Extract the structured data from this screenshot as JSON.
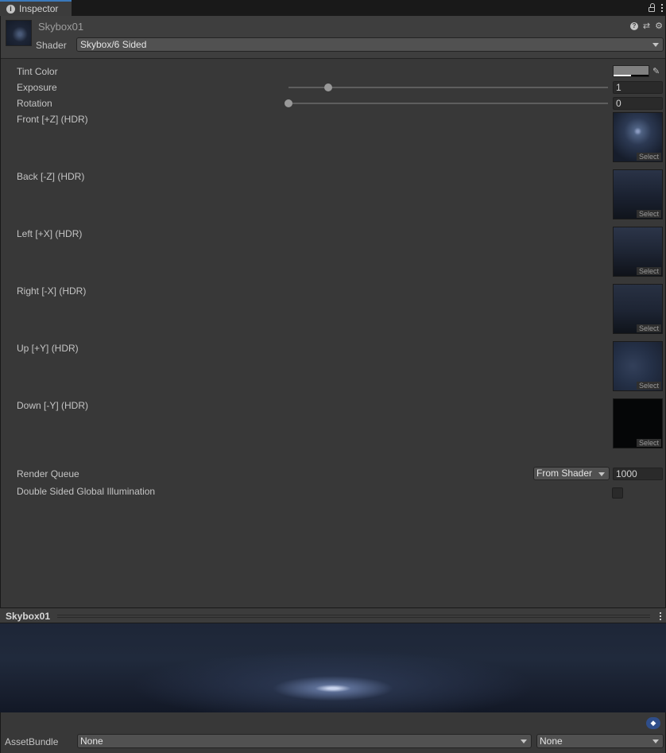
{
  "tab": {
    "title": "Inspector"
  },
  "material": {
    "name": "Skybox01",
    "shader_label": "Shader",
    "shader_value": "Skybox/6 Sided"
  },
  "properties": {
    "tint_color": {
      "label": "Tint Color",
      "color": "#808080"
    },
    "exposure": {
      "label": "Exposure",
      "value": "1",
      "slider_fraction": 0.125
    },
    "rotation": {
      "label": "Rotation",
      "value": "0",
      "slider_fraction": 0.0
    },
    "textures": [
      {
        "label": "Front [+Z]   (HDR)",
        "button": "Select"
      },
      {
        "label": "Back [-Z]   (HDR)",
        "button": "Select"
      },
      {
        "label": "Left [+X]   (HDR)",
        "button": "Select"
      },
      {
        "label": "Right [-X]   (HDR)",
        "button": "Select"
      },
      {
        "label": "Up [+Y]   (HDR)",
        "button": "Select"
      },
      {
        "label": "Down [-Y]   (HDR)",
        "button": "Select"
      }
    ],
    "render_queue": {
      "label": "Render Queue",
      "mode": "From Shader",
      "value": "1000"
    },
    "double_sided_gi": {
      "label": "Double Sided Global Illumination",
      "checked": false
    }
  },
  "preview": {
    "title": "Skybox01"
  },
  "asset_bundle": {
    "label": "AssetBundle",
    "name": "None",
    "variant": "None"
  },
  "colors": {
    "accent": "#3a79bb",
    "panel": "#383838",
    "tag": "#2f4e8a"
  }
}
